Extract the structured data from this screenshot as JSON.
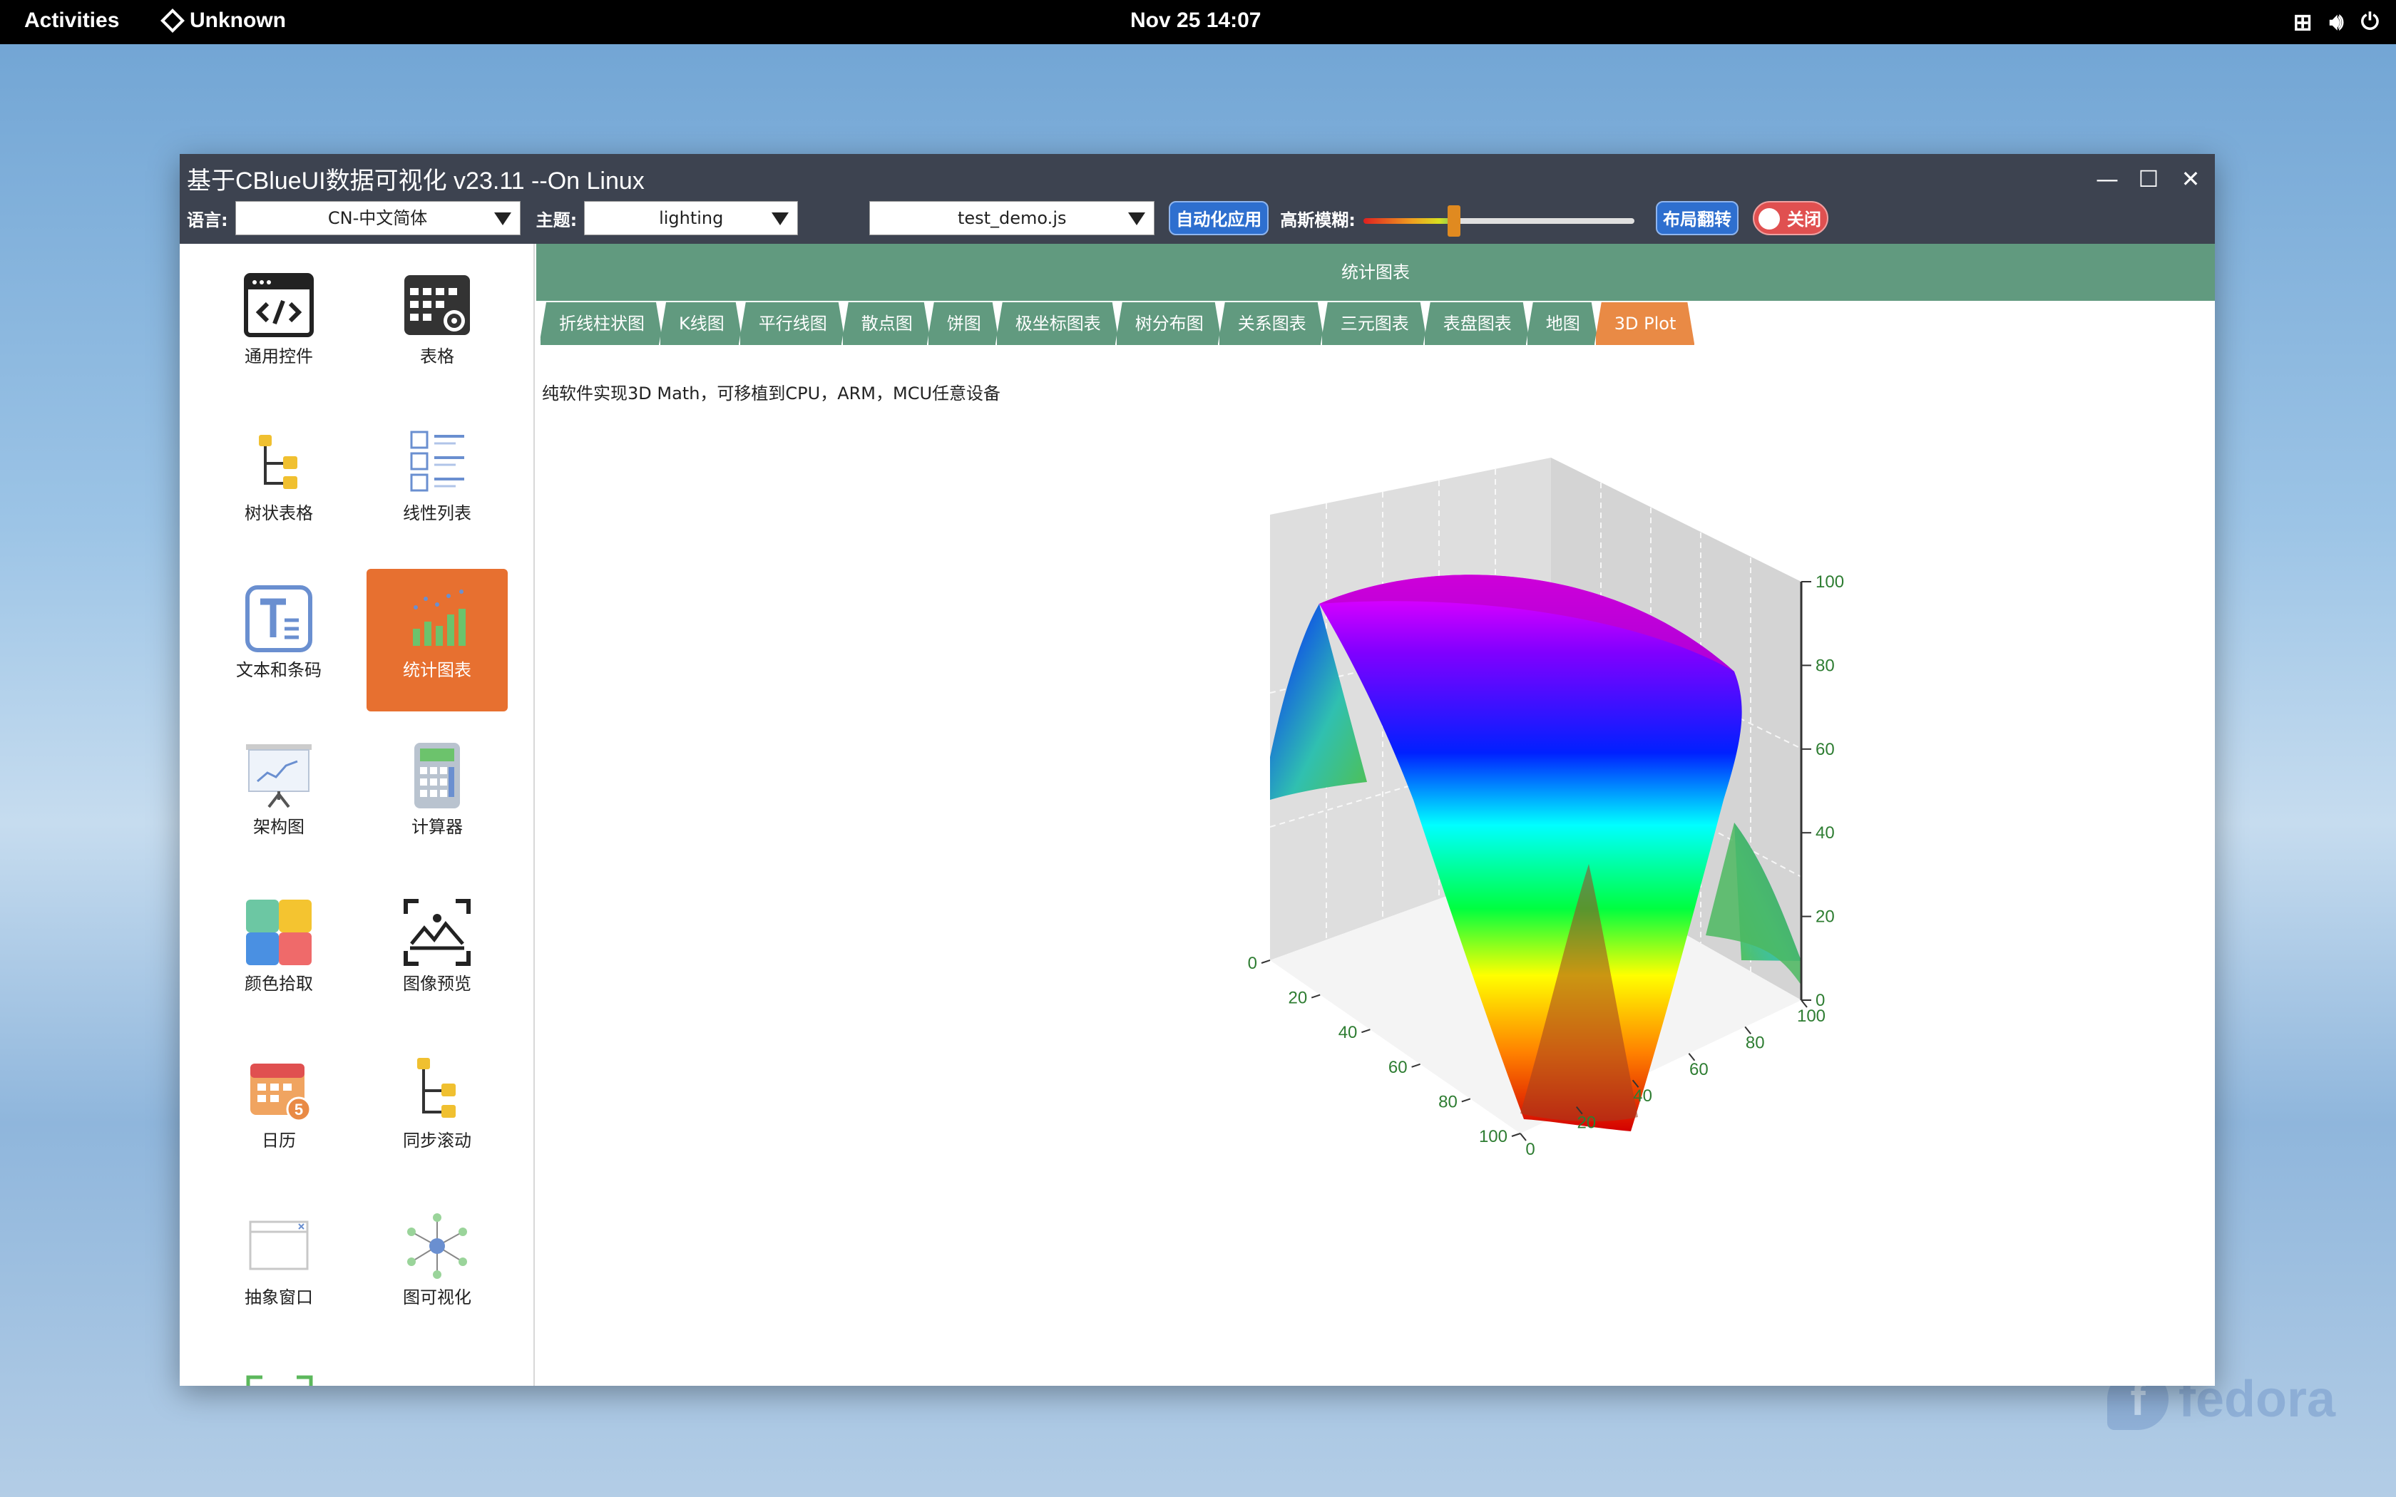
{
  "topbar": {
    "activities": "Activities",
    "app_name": "Unknown",
    "clock": "Nov 25  14:07",
    "icons": [
      "network-icon",
      "volume-icon",
      "power-icon"
    ]
  },
  "watermark": {
    "text": "fedora"
  },
  "window": {
    "title": "基于CBlueUI数据可视化 v23.11 --On Linux",
    "controls": [
      "minimize-icon",
      "maximize-icon",
      "close-icon"
    ],
    "toolbar": {
      "language_label": "语言:",
      "language_value": "CN-中文简体",
      "theme_label": "主题:",
      "theme_value": "lighting",
      "script_value": "test_demo.js",
      "auto_button": "自动化应用",
      "blur_label": "高斯模糊:",
      "blur_level": 0.33,
      "layout_button": "布局翻转",
      "toggle_label": "关闭"
    }
  },
  "sidebar": {
    "items": [
      {
        "label": "通用控件",
        "icon": "code-window-icon"
      },
      {
        "label": "表格",
        "icon": "table-gear-icon"
      },
      {
        "label": "树状表格",
        "icon": "tree-table-icon"
      },
      {
        "label": "线性列表",
        "icon": "list-icon"
      },
      {
        "label": "文本和条码",
        "icon": "text-icon"
      },
      {
        "label": "统计图表",
        "icon": "bar-chart-icon",
        "active": true
      },
      {
        "label": "架构图",
        "icon": "presentation-icon"
      },
      {
        "label": "计算器",
        "icon": "calculator-icon"
      },
      {
        "label": "颜色拾取",
        "icon": "color-palette-icon"
      },
      {
        "label": "图像预览",
        "icon": "image-preview-icon"
      },
      {
        "label": "日历",
        "icon": "calendar-icon"
      },
      {
        "label": "同步滚动",
        "icon": "sync-scroll-icon"
      },
      {
        "label": "抽象窗口",
        "icon": "abstract-window-icon"
      },
      {
        "label": "图可视化",
        "icon": "graph-icon"
      }
    ]
  },
  "main": {
    "header": "统计图表",
    "tabs": [
      "折线柱状图",
      "K线图",
      "平行线图",
      "散点图",
      "饼图",
      "极坐标图表",
      "树分布图",
      "关系图表",
      "三元图表",
      "表盘图表",
      "地图",
      "3D Plot"
    ],
    "active_tab": 11,
    "subtitle": "纯软件实现3D Math，可移植到CPU，ARM，MCU任意设备"
  },
  "chart_data": {
    "type": "surface3d",
    "x_ticks": [
      "0",
      "20",
      "40",
      "60",
      "80",
      "100"
    ],
    "y_ticks": [
      "0",
      "20",
      "40",
      "60",
      "80",
      "100"
    ],
    "z_ticks": [
      "0",
      "20",
      "40",
      "60",
      "80",
      "100"
    ],
    "xlim": [
      0,
      100
    ],
    "ylim": [
      0,
      100
    ],
    "zlim": [
      0,
      100
    ],
    "colormap": [
      "#d40000",
      "#ff8000",
      "#ffff00",
      "#00ff40",
      "#00ffff",
      "#0020ff",
      "#8000ff",
      "#ff00ff"
    ],
    "grid": true,
    "legend": "none"
  }
}
